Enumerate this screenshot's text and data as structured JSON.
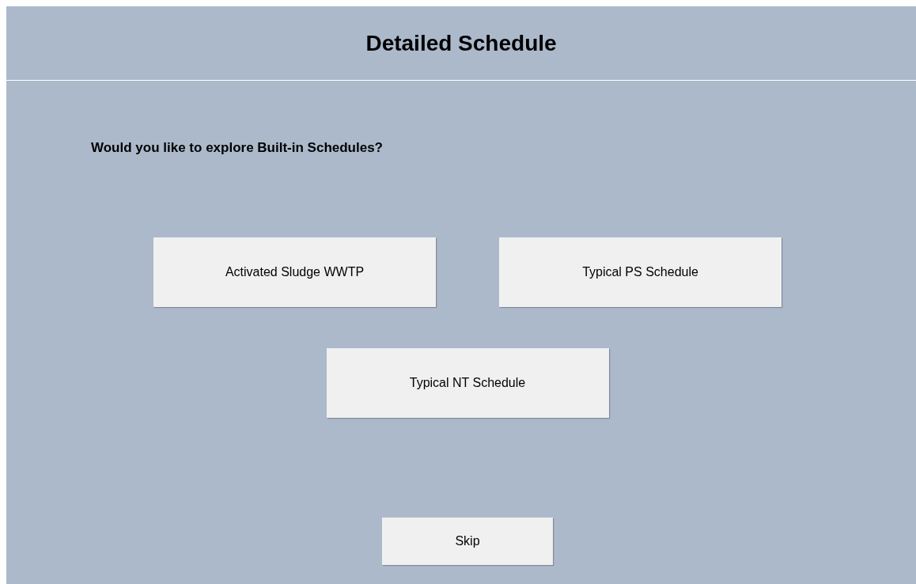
{
  "title": "Detailed Schedule",
  "question": "Would you like to explore Built-in Schedules?",
  "schedule_buttons": [
    {
      "label": "Activated Sludge WWTP"
    },
    {
      "label": "Typical PS Schedule"
    },
    {
      "label": "Typical NT Schedule"
    }
  ],
  "skip_button": {
    "label": "Skip"
  }
}
